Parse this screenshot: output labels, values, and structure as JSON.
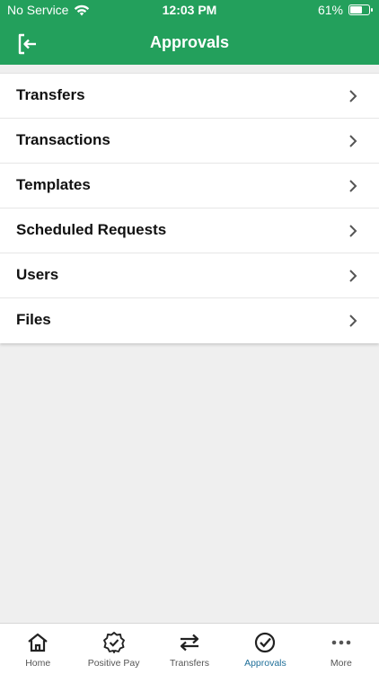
{
  "status_bar": {
    "carrier": "No Service",
    "time": "12:03 PM",
    "battery": "61%"
  },
  "header": {
    "title": "Approvals"
  },
  "menu": [
    {
      "label": "Transfers"
    },
    {
      "label": "Transactions"
    },
    {
      "label": "Templates"
    },
    {
      "label": "Scheduled Requests"
    },
    {
      "label": "Users"
    },
    {
      "label": "Files"
    }
  ],
  "tabs": [
    {
      "label": "Home",
      "icon": "home-icon"
    },
    {
      "label": "Positive Pay",
      "icon": "badge-check-icon"
    },
    {
      "label": "Transfers",
      "icon": "swap-arrows-icon"
    },
    {
      "label": "Approvals",
      "icon": "check-circle-icon",
      "active": true
    },
    {
      "label": "More",
      "icon": "more-dots-icon"
    }
  ],
  "colors": {
    "header": "#23a05c",
    "active_tab": "#1f6f99",
    "background": "#efefef"
  }
}
